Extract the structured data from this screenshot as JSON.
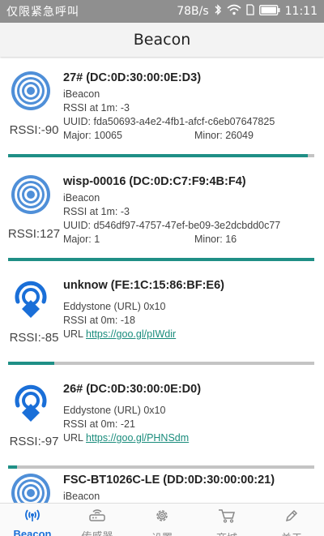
{
  "status_bar": {
    "carrier": "仅限紧急呼叫",
    "speed": "78B/s",
    "time": "11:11"
  },
  "app": {
    "title": "Beacon"
  },
  "beacons": [
    {
      "icon": "ibeacon-broadcast-icon",
      "name": "27# (DC:0D:30:00:0E:D3)",
      "type": "iBeacon",
      "rssi_ref": "RSSI at 1m: -3",
      "uuid": "UUID: fda50693-a4e2-4fb1-afcf-c6eb07647825",
      "major": "Major: 10065",
      "minor": "Minor: 26049",
      "rssi": "RSSI:-90",
      "signal_fraction": 0.98
    },
    {
      "icon": "ibeacon-broadcast-icon",
      "name": "wisp-00016 (DC:0D:C7:F9:4B:F4)",
      "type": "iBeacon",
      "rssi_ref": "RSSI at 1m: -3",
      "uuid": "UUID: d546df97-4757-47ef-be09-3e2dcbdd0c77",
      "major": "Major: 1",
      "minor": "Minor: 16",
      "rssi": "RSSI:127",
      "signal_fraction": 1.0
    },
    {
      "icon": "eddystone-pin-icon",
      "name": "unknow (FE:1C:15:86:BF:E6)",
      "type": "Eddystone (URL) 0x10",
      "rssi_ref": "RSSI at 0m: -18",
      "url_label": "URL ",
      "url": "https://goo.gl/pIWdir",
      "rssi": "RSSI:-85",
      "signal_fraction": 0.15
    },
    {
      "icon": "eddystone-pin-icon",
      "name": "26# (DC:0D:30:00:0E:D0)",
      "type": "Eddystone (URL) 0x10",
      "rssi_ref": "RSSI at 0m: -21",
      "url_label": "URL ",
      "url": "https://goo.gl/PHNSdm",
      "rssi": "RSSI:-97",
      "signal_fraction": 0.03
    },
    {
      "icon": "ibeacon-broadcast-icon",
      "name": "FSC-BT1026C-LE (DD:0D:30:00:00:21)",
      "type": "iBeacon"
    }
  ],
  "tabs": [
    {
      "label": "Beacon",
      "icon": "beacon-antenna-icon",
      "active": true
    },
    {
      "label": "传感器",
      "icon": "router-icon",
      "active": false
    },
    {
      "label": "设置",
      "icon": "gear-icon",
      "active": false
    },
    {
      "label": "商城",
      "icon": "cart-icon",
      "active": false
    },
    {
      "label": "关于",
      "icon": "pen-icon",
      "active": false
    }
  ],
  "colors": {
    "accent": "#1f8f86",
    "beacon_blue": "#1a6fd8",
    "status_bar": "#8f8f8f"
  }
}
